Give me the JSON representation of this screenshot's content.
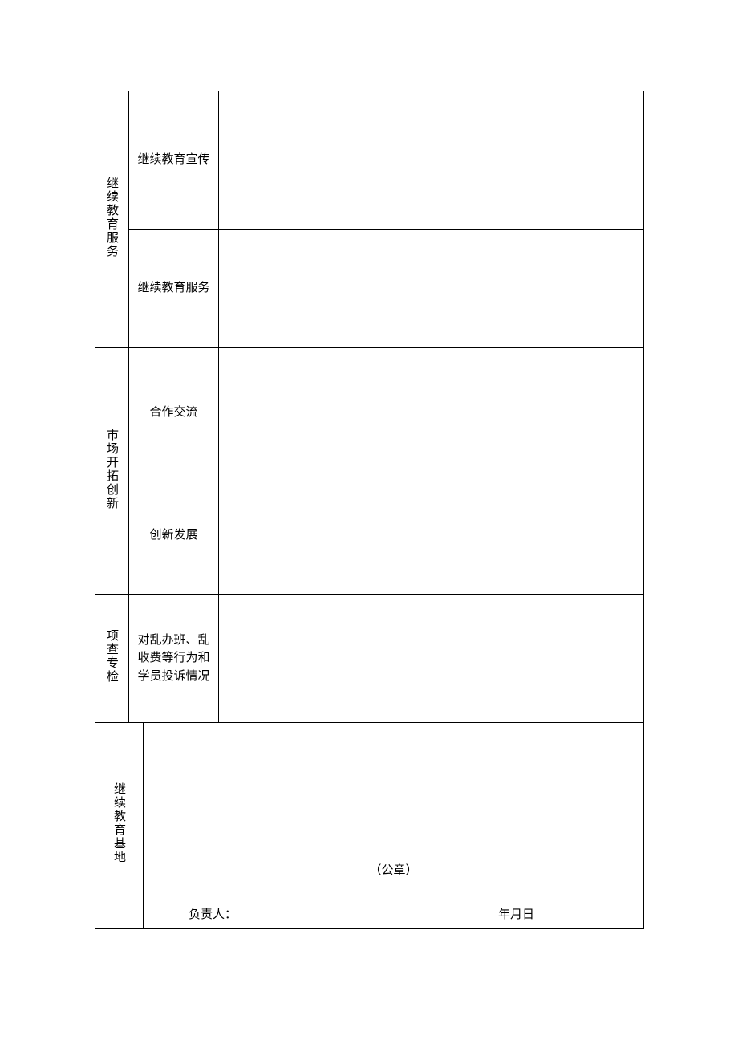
{
  "sections": [
    {
      "category": "继续教育服务",
      "items": [
        {
          "label": "继续教育宣传",
          "content": ""
        },
        {
          "label": "继续教育服务",
          "content": ""
        }
      ]
    },
    {
      "category": "市场开拓创新",
      "items": [
        {
          "label": "合作交流",
          "content": ""
        },
        {
          "label": "创新发展",
          "content": ""
        }
      ]
    },
    {
      "category": "项查专检",
      "items": [
        {
          "label": "对乱办班、乱收费等行为和学员投诉情况",
          "content": ""
        }
      ]
    }
  ],
  "signature_section": {
    "category": "继续教育基地",
    "seal": "（公章）",
    "person_label": "负责人：",
    "date_label": "年月日"
  }
}
